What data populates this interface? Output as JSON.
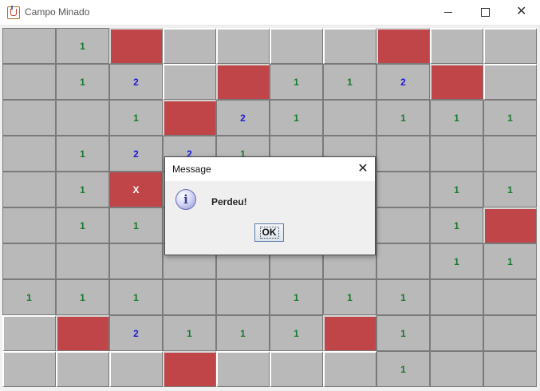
{
  "window": {
    "title": "Campo Minado",
    "minimize_icon": "minimize-icon",
    "maximize_icon": "maximize-icon",
    "close_label": "✕"
  },
  "colors": {
    "cell": "#b9b9b9",
    "bomb": "#c04548",
    "one": "#157a2d",
    "two": "#1a1ad9"
  },
  "board": {
    "rows": [
      [
        "",
        "1",
        "B",
        "H",
        "H",
        "H",
        "H",
        "B",
        "H",
        "H"
      ],
      [
        "",
        "1",
        "2",
        "H",
        "B",
        "1",
        "1",
        "2",
        "B",
        "H"
      ],
      [
        "",
        "",
        "1",
        "B",
        "2",
        "1",
        "",
        "1",
        "1",
        "1"
      ],
      [
        "",
        "1",
        "2",
        "2",
        "1",
        "",
        "",
        "",
        "",
        ""
      ],
      [
        "",
        "1",
        "X",
        "",
        "",
        "",
        "",
        "",
        "1",
        "1"
      ],
      [
        "",
        "1",
        "1",
        "",
        "",
        "",
        "",
        "",
        "1",
        "B"
      ],
      [
        "",
        "",
        "",
        "",
        "",
        "",
        "",
        "",
        "1",
        "1"
      ],
      [
        "1",
        "1",
        "1",
        "",
        "",
        "1",
        "1",
        "1",
        "",
        ""
      ],
      [
        "H",
        "B",
        "2",
        "1",
        "1",
        "1",
        "B",
        "1",
        "",
        ""
      ],
      [
        "H",
        "H",
        "H",
        "B",
        "H",
        "H",
        "H",
        "1",
        "",
        ""
      ]
    ]
  },
  "dialog": {
    "title": "Message",
    "close_label": "✕",
    "icon": "information-icon",
    "icon_glyph": "i",
    "message": "Perdeu!",
    "ok_label": "OK"
  }
}
